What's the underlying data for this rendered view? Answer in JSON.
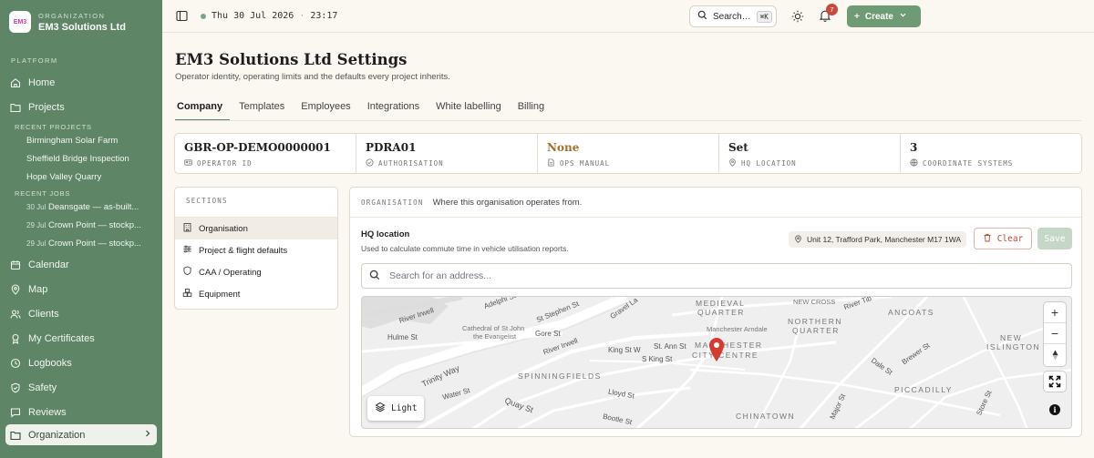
{
  "sidebar": {
    "org_logo_text": "EM3",
    "org_label": "ORGANIZATION",
    "org_name": "EM3 Solutions Ltd",
    "section_platform": "PLATFORM",
    "home": "Home",
    "projects": "Projects",
    "recent_projects_head": "RECENT PROJECTS",
    "recent_projects": [
      "Birmingham Solar Farm",
      "Sheffield Bridge Inspection",
      "Hope Valley Quarry"
    ],
    "recent_jobs_head": "RECENT JOBS",
    "recent_jobs": [
      {
        "date": "30 Jul",
        "name": "Deansgate — as-built..."
      },
      {
        "date": "29 Jul",
        "name": "Crown Point — stockp..."
      },
      {
        "date": "29 Jul",
        "name": "Crown Point — stockp..."
      }
    ],
    "calendar": "Calendar",
    "map": "Map",
    "clients": "Clients",
    "certificates": "My Certificates",
    "logbooks": "Logbooks",
    "safety": "Safety",
    "reviews": "Reviews",
    "organization": "Organization"
  },
  "topbar": {
    "date": "Thu 30 Jul 2026",
    "time": "23:17",
    "search_label": "Search…",
    "search_kbd": "⌘K",
    "notifications_count": "7",
    "create_label": "Create"
  },
  "page": {
    "title": "EM3 Solutions Ltd Settings",
    "subtitle": "Operator identity, operating limits and the defaults every project inherits.",
    "tabs": [
      "Company",
      "Templates",
      "Employees",
      "Integrations",
      "White labelling",
      "Billing"
    ]
  },
  "kpis": [
    {
      "value": "GBR-OP-DEMO0000001",
      "label": "OPERATOR ID"
    },
    {
      "value": "PDRA01",
      "label": "AUTHORISATION"
    },
    {
      "value": "None",
      "label": "OPS MANUAL"
    },
    {
      "value": "Set",
      "label": "HQ LOCATION"
    },
    {
      "value": "3",
      "label": "COORDINATE SYSTEMS"
    }
  ],
  "sections": {
    "head": "SECTIONS",
    "items": [
      "Organisation",
      "Project & flight defaults",
      "CAA / Operating",
      "Equipment"
    ]
  },
  "organisation": {
    "label": "ORGANISATION",
    "desc": "Where this organisation operates from.",
    "hq_label": "HQ location",
    "hq_desc": "Used to calculate commute time in vehicle utilisation reports.",
    "address": "Unit 12, Trafford Park, Manchester M17 1WA",
    "clear_label": "Clear",
    "save_label": "Save",
    "search_placeholder": "Search for an address..."
  },
  "map": {
    "light_label": "Light",
    "labels": {
      "medieval": "MEDIEVAL",
      "quarter": "QUARTER",
      "new_cross": "NEW CROSS",
      "ancoats": "ANCOATS",
      "northern": "NORTHERN",
      "northern_quarter": "QUARTER",
      "new": "NEW",
      "islington": "ISLINGTON",
      "manchester": "MANCHESTER",
      "centre": "CITY CENTRE",
      "spinningfields": "SPINNINGFIELDS",
      "piccadilly": "PICCADILLY",
      "chinatown": "CHINATOWN",
      "cathedral1": "Cathedral of St John",
      "cathedral2": "the Evangelist",
      "arndale": "Manchester Arndale",
      "adelphi": "Adelphi St",
      "river_irwell": "River Irwell",
      "st_stephen": "St Stephen St",
      "gravel": "Gravel La",
      "gore": "Gore St",
      "river_irwell2": "River Irwell",
      "hulme": "Hulme St",
      "king_st_w": "King St W",
      "st_ann": "St. Ann St",
      "s_king": "S King St",
      "trinity": "Trinity Way",
      "water": "Water St",
      "quay": "Quay St",
      "lloyd": "Lloyd St",
      "bootle": "Bootle St",
      "river_tib": "River Tib",
      "brewer": "Brewer St",
      "dale": "Dale St",
      "major": "Major St",
      "store": "Store St"
    }
  },
  "colors": {
    "sidebar": "#5e8566",
    "accent": "#6e9b74",
    "danger": "#b84a3a",
    "pin": "#d63a30"
  }
}
